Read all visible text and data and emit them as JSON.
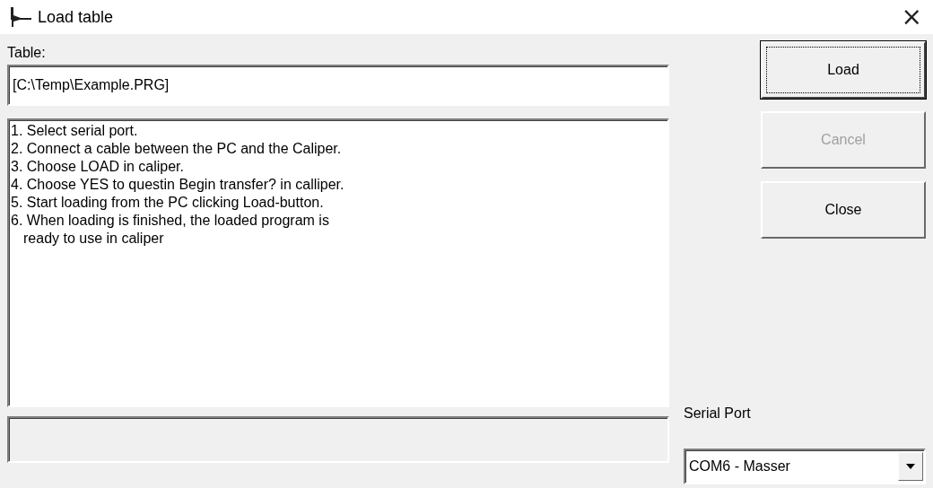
{
  "window": {
    "title": "Load table",
    "close": "×"
  },
  "table": {
    "label": "Table:",
    "value": "[C:\\Temp\\Example.PRG]"
  },
  "instructions": [
    "1. Select serial port.",
    "2. Connect a cable between the PC and the Caliper.",
    "3. Choose LOAD in caliper.",
    "4. Choose YES to questin Begin transfer? in calliper.",
    "5. Start loading from the PC clicking Load-button.",
    "6. When loading is finished, the loaded program is",
    "ready to use in caliper"
  ],
  "buttons": [
    {
      "label": "Load",
      "focused": true,
      "disabled": false
    },
    {
      "label": "Cancel",
      "focused": false,
      "disabled": true
    },
    {
      "label": "Close",
      "focused": false,
      "disabled": false
    }
  ],
  "serial_port": {
    "label": "Serial Port",
    "value": "COM6 - Masser"
  }
}
